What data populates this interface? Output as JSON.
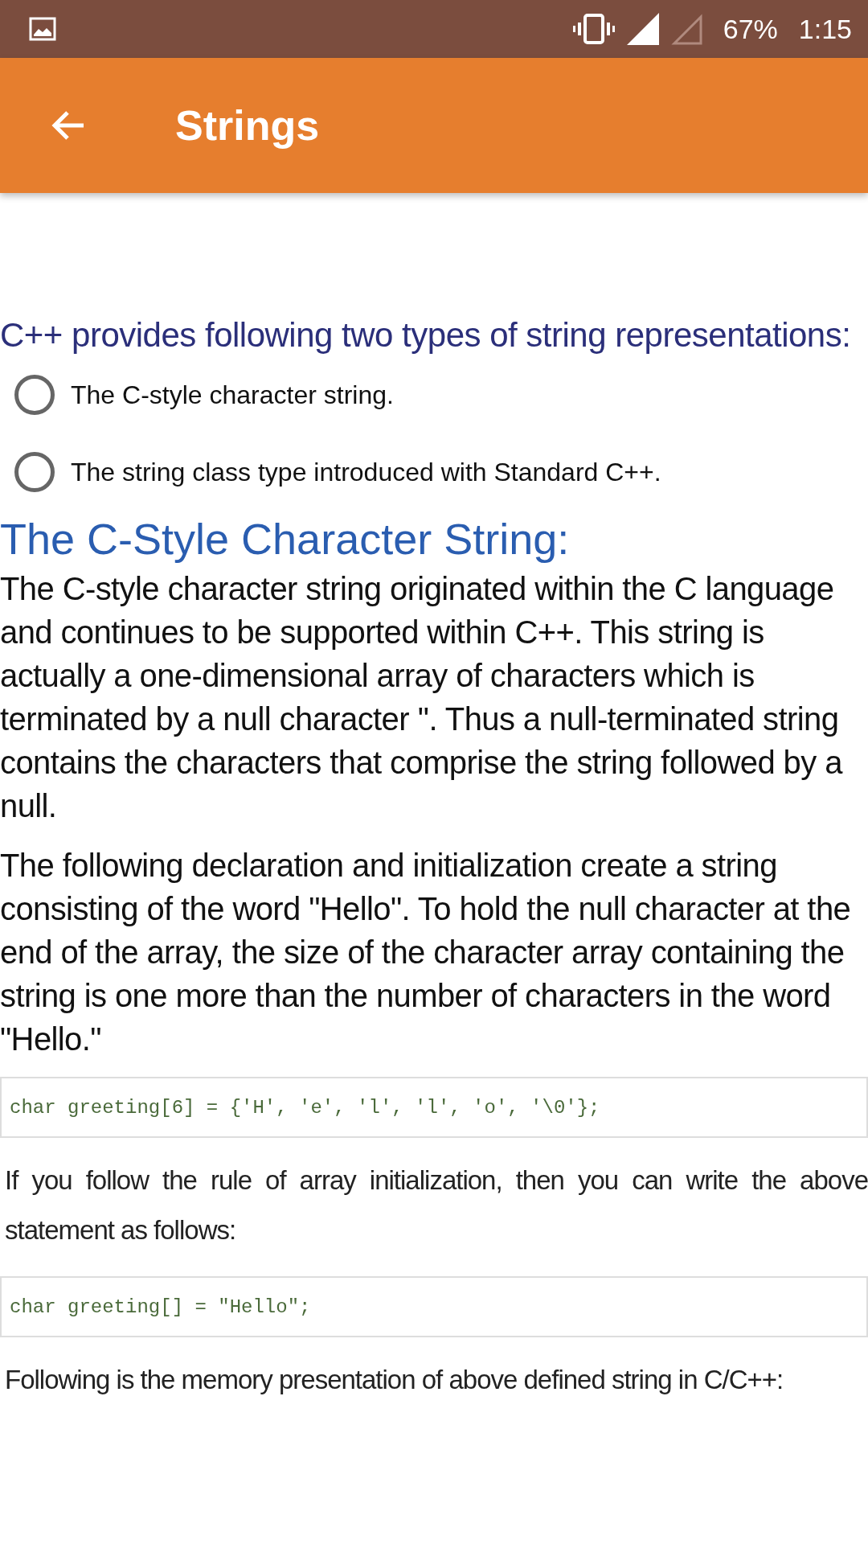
{
  "status_bar": {
    "battery": "67%",
    "time": "1:15"
  },
  "app_bar": {
    "title": "Strings"
  },
  "intro": "C++ provides following two types of string representations:",
  "options": [
    {
      "label": "The C-style character string.",
      "selected": false
    },
    {
      "label": "The string class type introduced with Standard C++.",
      "selected": false
    }
  ],
  "heading": "The C-Style Character String:",
  "content": [
    {
      "kind": "para",
      "text": "The C-style character string originated within the C language and continues to be supported within C++. This string is actually a one-dimensional array of characters which is terminated by a null character ''. Thus a null-terminated string contains the characters that comprise the string followed by a null."
    },
    {
      "kind": "para",
      "text": "The following declaration and initialization create a string consisting of the word \"Hello\". To hold the null character at the end of the array, the size of the character array containing the string is one more than the number of characters in the word \"Hello.\""
    },
    {
      "kind": "code",
      "text": "char greeting[6] = {'H', 'e', 'l', 'l', 'o', '\\0'};"
    },
    {
      "kind": "note",
      "text": "If you follow the rule of array initialization, then you can write the above statement as follows:"
    },
    {
      "kind": "code",
      "text": "char greeting[] = \"Hello\";"
    },
    {
      "kind": "note",
      "text": "Following is the memory presentation of above defined string in C/C++:"
    }
  ]
}
